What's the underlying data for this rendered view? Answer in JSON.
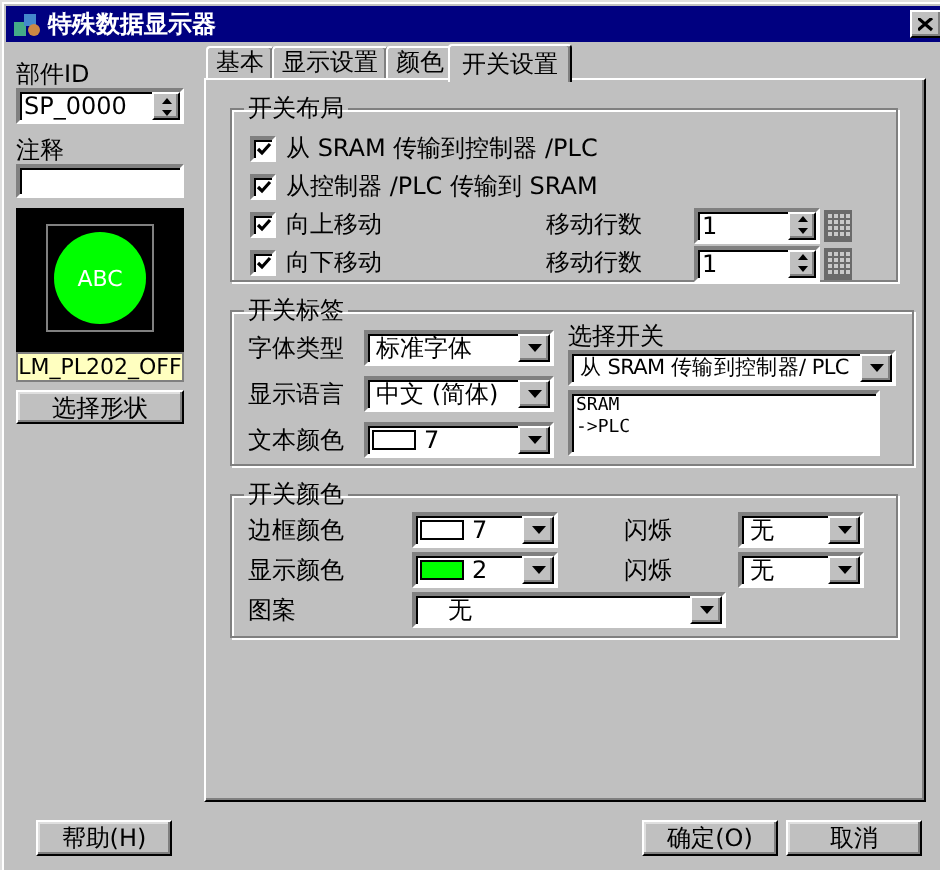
{
  "window": {
    "title": "特殊数据显示器"
  },
  "part": {
    "id_label": "部件ID",
    "id_value": "SP_0000",
    "comment_label": "注释",
    "preview_text": "ABC",
    "shape_name": "LM_PL202_OFF",
    "shape_button": "选择形状"
  },
  "tabs": [
    {
      "label": "基本",
      "selected": false
    },
    {
      "label": "显示设置",
      "selected": false
    },
    {
      "label": "颜色",
      "selected": false
    },
    {
      "label": "开关设置",
      "selected": true
    }
  ],
  "layout_group": {
    "title": "开关布局",
    "rows": [
      {
        "label": "从 SRAM 传输到控制器 /PLC",
        "checked": true
      },
      {
        "label": "从控制器 /PLC 传输到 SRAM",
        "checked": true
      },
      {
        "label": "向上移动",
        "checked": true,
        "spin_label": "移动行数",
        "spin_value": "1"
      },
      {
        "label": "向下移动",
        "checked": true,
        "spin_label": "移动行数",
        "spin_value": "1"
      }
    ]
  },
  "label_group": {
    "title": "开关标签",
    "fields": [
      {
        "label": "字体类型",
        "value": "标准字体"
      },
      {
        "label": "显示语言",
        "value": "中文 (简体)"
      },
      {
        "label": "文本颜色",
        "value": "7",
        "color": "#ffffff"
      }
    ],
    "select_label": "选择开关",
    "select_value": "从 SRAM 传输到控制器/ PLC",
    "preview_lines": [
      "SRAM",
      "->PLC"
    ]
  },
  "color_group": {
    "title": "开关颜色",
    "rows": [
      {
        "label": "边框颜色",
        "value": "7",
        "color": "#ffffff",
        "blink_label": "闪烁",
        "blink_value": "无"
      },
      {
        "label": "显示颜色",
        "value": "2",
        "color": "#00ff00",
        "blink_label": "闪烁",
        "blink_value": "无"
      }
    ],
    "pattern_label": "图案",
    "pattern_value": "无"
  },
  "buttons": [
    {
      "label": "帮助(H)"
    },
    {
      "label": "确定(O)"
    },
    {
      "label": "取消"
    }
  ]
}
